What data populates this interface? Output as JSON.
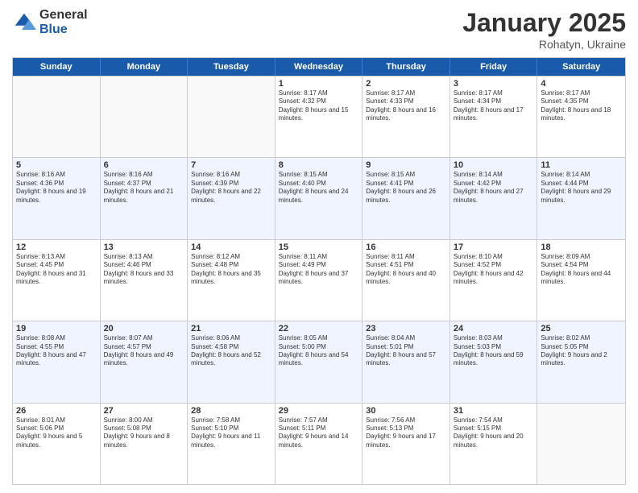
{
  "logo": {
    "general": "General",
    "blue": "Blue"
  },
  "title": "January 2025",
  "subtitle": "Rohatyn, Ukraine",
  "headers": [
    "Sunday",
    "Monday",
    "Tuesday",
    "Wednesday",
    "Thursday",
    "Friday",
    "Saturday"
  ],
  "weeks": [
    [
      {
        "day": "",
        "sunrise": "",
        "sunset": "",
        "daylight": "",
        "empty": true
      },
      {
        "day": "",
        "sunrise": "",
        "sunset": "",
        "daylight": "",
        "empty": true
      },
      {
        "day": "",
        "sunrise": "",
        "sunset": "",
        "daylight": "",
        "empty": true
      },
      {
        "day": "1",
        "sunrise": "Sunrise: 8:17 AM",
        "sunset": "Sunset: 4:32 PM",
        "daylight": "Daylight: 8 hours and 15 minutes."
      },
      {
        "day": "2",
        "sunrise": "Sunrise: 8:17 AM",
        "sunset": "Sunset: 4:33 PM",
        "daylight": "Daylight: 8 hours and 16 minutes."
      },
      {
        "day": "3",
        "sunrise": "Sunrise: 8:17 AM",
        "sunset": "Sunset: 4:34 PM",
        "daylight": "Daylight: 8 hours and 17 minutes."
      },
      {
        "day": "4",
        "sunrise": "Sunrise: 8:17 AM",
        "sunset": "Sunset: 4:35 PM",
        "daylight": "Daylight: 8 hours and 18 minutes."
      }
    ],
    [
      {
        "day": "5",
        "sunrise": "Sunrise: 8:16 AM",
        "sunset": "Sunset: 4:36 PM",
        "daylight": "Daylight: 8 hours and 19 minutes."
      },
      {
        "day": "6",
        "sunrise": "Sunrise: 8:16 AM",
        "sunset": "Sunset: 4:37 PM",
        "daylight": "Daylight: 8 hours and 21 minutes."
      },
      {
        "day": "7",
        "sunrise": "Sunrise: 8:16 AM",
        "sunset": "Sunset: 4:39 PM",
        "daylight": "Daylight: 8 hours and 22 minutes."
      },
      {
        "day": "8",
        "sunrise": "Sunrise: 8:15 AM",
        "sunset": "Sunset: 4:40 PM",
        "daylight": "Daylight: 8 hours and 24 minutes."
      },
      {
        "day": "9",
        "sunrise": "Sunrise: 8:15 AM",
        "sunset": "Sunset: 4:41 PM",
        "daylight": "Daylight: 8 hours and 26 minutes."
      },
      {
        "day": "10",
        "sunrise": "Sunrise: 8:14 AM",
        "sunset": "Sunset: 4:42 PM",
        "daylight": "Daylight: 8 hours and 27 minutes."
      },
      {
        "day": "11",
        "sunrise": "Sunrise: 8:14 AM",
        "sunset": "Sunset: 4:44 PM",
        "daylight": "Daylight: 8 hours and 29 minutes."
      }
    ],
    [
      {
        "day": "12",
        "sunrise": "Sunrise: 8:13 AM",
        "sunset": "Sunset: 4:45 PM",
        "daylight": "Daylight: 8 hours and 31 minutes."
      },
      {
        "day": "13",
        "sunrise": "Sunrise: 8:13 AM",
        "sunset": "Sunset: 4:46 PM",
        "daylight": "Daylight: 8 hours and 33 minutes."
      },
      {
        "day": "14",
        "sunrise": "Sunrise: 8:12 AM",
        "sunset": "Sunset: 4:48 PM",
        "daylight": "Daylight: 8 hours and 35 minutes."
      },
      {
        "day": "15",
        "sunrise": "Sunrise: 8:11 AM",
        "sunset": "Sunset: 4:49 PM",
        "daylight": "Daylight: 8 hours and 37 minutes."
      },
      {
        "day": "16",
        "sunrise": "Sunrise: 8:11 AM",
        "sunset": "Sunset: 4:51 PM",
        "daylight": "Daylight: 8 hours and 40 minutes."
      },
      {
        "day": "17",
        "sunrise": "Sunrise: 8:10 AM",
        "sunset": "Sunset: 4:52 PM",
        "daylight": "Daylight: 8 hours and 42 minutes."
      },
      {
        "day": "18",
        "sunrise": "Sunrise: 8:09 AM",
        "sunset": "Sunset: 4:54 PM",
        "daylight": "Daylight: 8 hours and 44 minutes."
      }
    ],
    [
      {
        "day": "19",
        "sunrise": "Sunrise: 8:08 AM",
        "sunset": "Sunset: 4:55 PM",
        "daylight": "Daylight: 8 hours and 47 minutes."
      },
      {
        "day": "20",
        "sunrise": "Sunrise: 8:07 AM",
        "sunset": "Sunset: 4:57 PM",
        "daylight": "Daylight: 8 hours and 49 minutes."
      },
      {
        "day": "21",
        "sunrise": "Sunrise: 8:06 AM",
        "sunset": "Sunset: 4:58 PM",
        "daylight": "Daylight: 8 hours and 52 minutes."
      },
      {
        "day": "22",
        "sunrise": "Sunrise: 8:05 AM",
        "sunset": "Sunset: 5:00 PM",
        "daylight": "Daylight: 8 hours and 54 minutes."
      },
      {
        "day": "23",
        "sunrise": "Sunrise: 8:04 AM",
        "sunset": "Sunset: 5:01 PM",
        "daylight": "Daylight: 8 hours and 57 minutes."
      },
      {
        "day": "24",
        "sunrise": "Sunrise: 8:03 AM",
        "sunset": "Sunset: 5:03 PM",
        "daylight": "Daylight: 8 hours and 59 minutes."
      },
      {
        "day": "25",
        "sunrise": "Sunrise: 8:02 AM",
        "sunset": "Sunset: 5:05 PM",
        "daylight": "Daylight: 9 hours and 2 minutes."
      }
    ],
    [
      {
        "day": "26",
        "sunrise": "Sunrise: 8:01 AM",
        "sunset": "Sunset: 5:06 PM",
        "daylight": "Daylight: 9 hours and 5 minutes."
      },
      {
        "day": "27",
        "sunrise": "Sunrise: 8:00 AM",
        "sunset": "Sunset: 5:08 PM",
        "daylight": "Daylight: 9 hours and 8 minutes."
      },
      {
        "day": "28",
        "sunrise": "Sunrise: 7:58 AM",
        "sunset": "Sunset: 5:10 PM",
        "daylight": "Daylight: 9 hours and 11 minutes."
      },
      {
        "day": "29",
        "sunrise": "Sunrise: 7:57 AM",
        "sunset": "Sunset: 5:11 PM",
        "daylight": "Daylight: 9 hours and 14 minutes."
      },
      {
        "day": "30",
        "sunrise": "Sunrise: 7:56 AM",
        "sunset": "Sunset: 5:13 PM",
        "daylight": "Daylight: 9 hours and 17 minutes."
      },
      {
        "day": "31",
        "sunrise": "Sunrise: 7:54 AM",
        "sunset": "Sunset: 5:15 PM",
        "daylight": "Daylight: 9 hours and 20 minutes."
      },
      {
        "day": "",
        "sunrise": "",
        "sunset": "",
        "daylight": "",
        "empty": true
      }
    ]
  ]
}
